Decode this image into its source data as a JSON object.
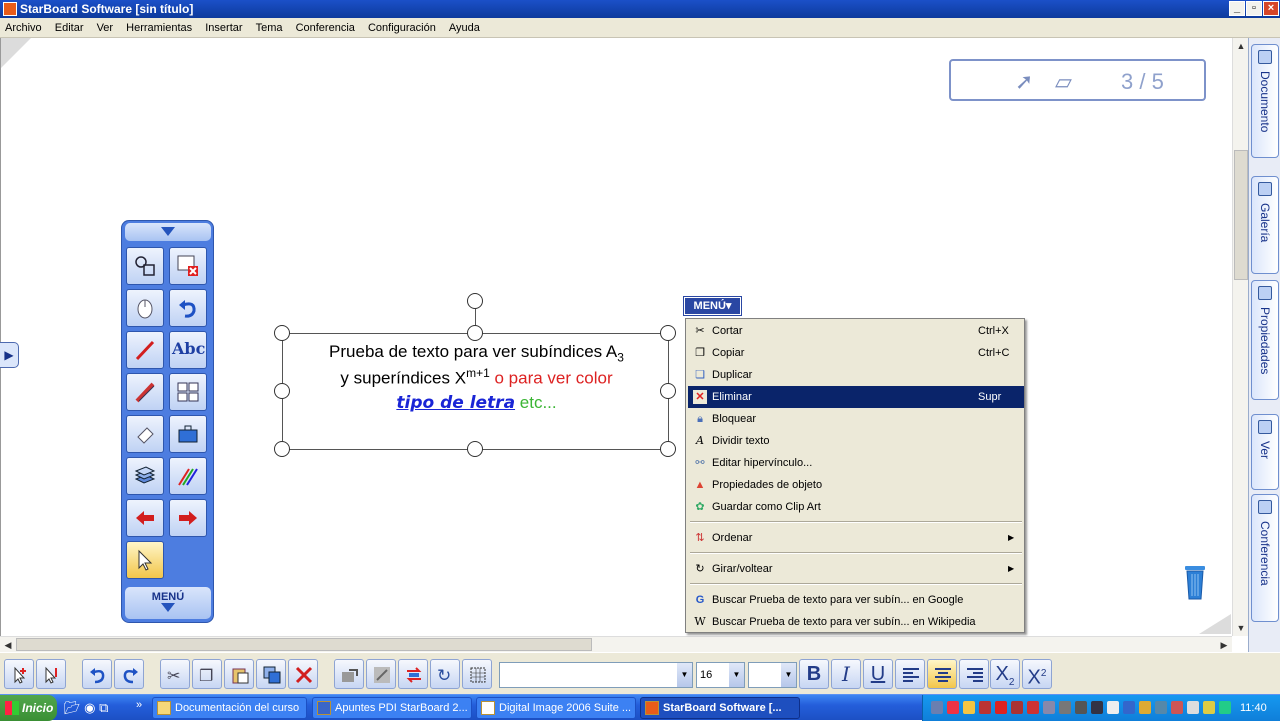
{
  "window": {
    "title": "StarBoard Software [sin título]"
  },
  "menubar": [
    "Archivo",
    "Editar",
    "Ver",
    "Herramientas",
    "Insertar",
    "Tema",
    "Conferencia",
    "Configuración",
    "Ayuda"
  ],
  "page_indicator": "3 / 5",
  "side_tabs": [
    "Documento",
    "Galería",
    "Propiedades",
    "Ver",
    "Conferencia"
  ],
  "tool_panel": {
    "menu_label": "MENÚ"
  },
  "text_object": {
    "line1": "Prueba de texto para ver subíndices A",
    "line1_sub": "3",
    "line2_a": "y superíndices X",
    "line2_sup": "m+1",
    "line2_b": " o para ver color",
    "line3_a": "tipo de letra",
    "line3_b": " etc..."
  },
  "context_menu": {
    "tag": "MENÚ",
    "items": [
      {
        "label": "Cortar",
        "shortcut": "Ctrl+X"
      },
      {
        "label": "Copiar",
        "shortcut": "Ctrl+C"
      },
      {
        "label": "Duplicar",
        "shortcut": ""
      },
      {
        "label": "Eliminar",
        "shortcut": "Supr"
      },
      {
        "label": "Bloquear",
        "shortcut": ""
      },
      {
        "label": "Dividir texto",
        "shortcut": ""
      },
      {
        "label": "Editar hipervínculo...",
        "shortcut": ""
      },
      {
        "label": "Propiedades de objeto",
        "shortcut": ""
      },
      {
        "label": "Guardar como Clip Art",
        "shortcut": ""
      },
      {
        "label": "Ordenar",
        "shortcut": ""
      },
      {
        "label": "Girar/voltear",
        "shortcut": ""
      },
      {
        "label": "Buscar Prueba de texto para ver subín... en Google",
        "shortcut": ""
      },
      {
        "label": "Buscar Prueba de texto para ver subín... en Wikipedia",
        "shortcut": ""
      }
    ]
  },
  "format_bar": {
    "font_name": "",
    "font_size": "16",
    "font_color": "",
    "subscript_label": "X",
    "subscript_mark": "2",
    "superscript_label": "X",
    "superscript_mark": "2",
    "bold": "B",
    "italic": "I",
    "underline": "U"
  },
  "taskbar": {
    "start": "Inicio",
    "tasks": [
      "Documentación del curso",
      "Apuntes PDI StarBoard 2...",
      "Digital Image 2006 Suite ...",
      "StarBoard Software [..."
    ],
    "clock": "11:40"
  },
  "colors": {
    "title_bar": "#0d3a9c",
    "selection": "#0a246a",
    "tool_panel": "#4d7de0",
    "text_red": "#dd2222",
    "text_blue": "#1a25d6",
    "text_green": "#3bb534"
  }
}
